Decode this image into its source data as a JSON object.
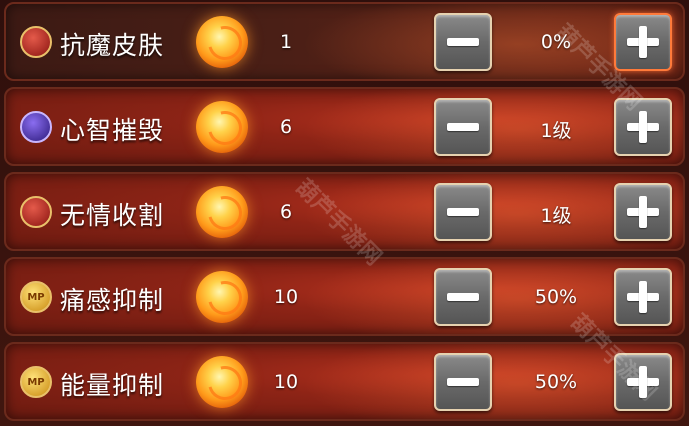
{
  "skills": [
    {
      "name": "抗魔皮肤",
      "icon": "shield-red-icon",
      "icon_text": "",
      "points": "1",
      "value": "0%"
    },
    {
      "name": "心智摧毁",
      "icon": "brain-purple-icon",
      "icon_text": "",
      "points": "6",
      "value": "1级"
    },
    {
      "name": "无情收割",
      "icon": "reaper-red-icon",
      "icon_text": "",
      "points": "6",
      "value": "1级"
    },
    {
      "name": "痛感抑制",
      "icon": "mp-gold-icon",
      "icon_text": "MP",
      "points": "10",
      "value": "50%"
    },
    {
      "name": "能量抑制",
      "icon": "mp-gold-icon",
      "icon_text": "MP",
      "points": "10",
      "value": "50%"
    }
  ],
  "watermark": "葫芦手游网"
}
